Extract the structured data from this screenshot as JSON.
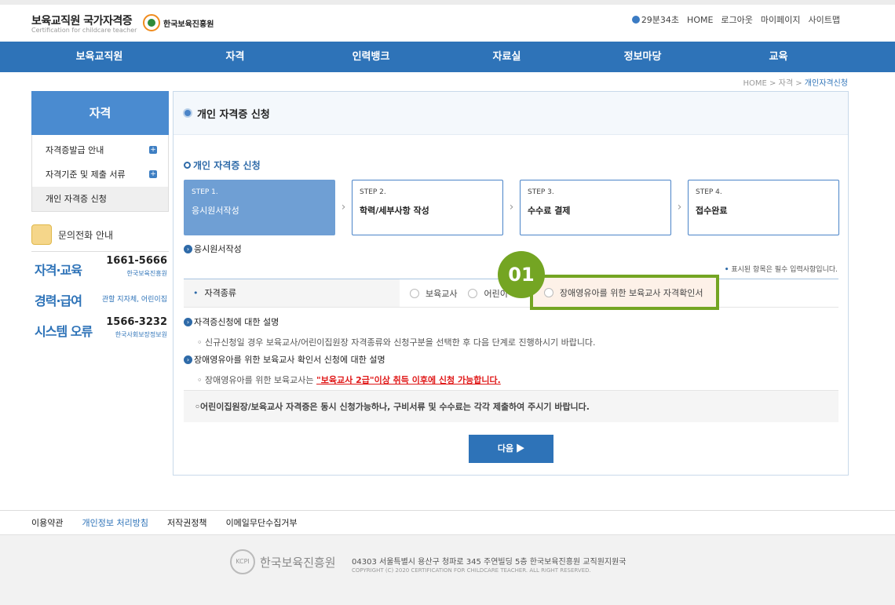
{
  "header": {
    "title": "보육교직원 국가자격증",
    "subtitle": "Certification for childcare teacher",
    "org_logo_text": "한국보육진흥원",
    "timer": "29분34초",
    "util_links": [
      "HOME",
      "로그아웃",
      "마이페이지",
      "사이트맵"
    ]
  },
  "gnb": [
    "보육교직원",
    "자격",
    "인력뱅크",
    "자료실",
    "정보마당",
    "교육"
  ],
  "breadcrumb": {
    "home": "HOME",
    "sep1": ">",
    "mid": "자격",
    "sep2": ">",
    "current": "개인자격신청"
  },
  "sidebar": {
    "title": "자격",
    "items": [
      {
        "label": "자격증발급 안내",
        "icon": "plus-icon"
      },
      {
        "label": "자격기준 및 제출 서류",
        "icon": "plus-icon"
      },
      {
        "label": "개인 자격증 신청"
      }
    ],
    "inquiry_title": "문의전화 안내",
    "phones": [
      {
        "name": "자격·교육",
        "number": "1661-5666",
        "org": "한국보육진흥원"
      },
      {
        "name": "경력·급여",
        "number": "",
        "org": "관할 지자체, 어린이집"
      },
      {
        "name": "시스템 오류",
        "number": "1566-3232",
        "org": "한국사회보장정보원"
      }
    ]
  },
  "main": {
    "page_title": "개인 자격증 신청",
    "section_title": "개인 자격증 신청",
    "steps": [
      {
        "num": "STEP 1.",
        "label": "응시원서작성",
        "active": true
      },
      {
        "num": "STEP 2.",
        "label": "학력/세부사항 작성"
      },
      {
        "num": "STEP 3.",
        "label": "수수료 결제"
      },
      {
        "num": "STEP 4.",
        "label": "접수완료"
      }
    ],
    "form_heading": "응시원서작성",
    "required_note_star": "•",
    "required_note": "표시된 항목은 필수 입력사항입니다.",
    "field_label": "자격종류",
    "radio_options": [
      "보육교사",
      "어린이"
    ],
    "highlighted_option": "장애영유아를 위한 보육교사 자격확인서",
    "badge": "01",
    "desc1_heading": "자격증신청에 대한 설명",
    "desc1_text": "◦ 신규신청일 경우 보육교사/어린이집원장 자격종류와 신청구분을 선택한 후 다음 단계로 진행하시기 바랍니다.",
    "desc2_heading": "장애영유아를 위한 보육교사 확인서 신청에 대한 설명",
    "desc2_prefix": "◦ 장애영유아를 위한 보육교사는 ",
    "desc2_warning": "\"보육교사 2급\"이상 취득 이후에 신청 가능합니다.",
    "notice": "◦어린이집원장/보육교사 자격증은 동시 신청가능하나, 구비서류 및 수수료는 각각 제출하여 주시기 바랍니다.",
    "next_button": "다음 ▶"
  },
  "footer": {
    "links": [
      "이용약관",
      "개인정보 처리방침",
      "저작권정책",
      "이메일무단수집거부"
    ],
    "logo_mark": "KCPI",
    "logo_text": "한국보육진흥원",
    "address": "04303 서울특별시 용산구 청파로 345 주연빌딩 5층 한국보육진흥원 교직원지원국",
    "copyright": "COPYRIGHT (C) 2020 CERTIFICATION FOR CHILDCARE TEACHER. ALL RIGHT RESERVED."
  },
  "colors": {
    "primary": "#2e73b8",
    "highlight": "#74a523",
    "warning": "#e01818"
  }
}
